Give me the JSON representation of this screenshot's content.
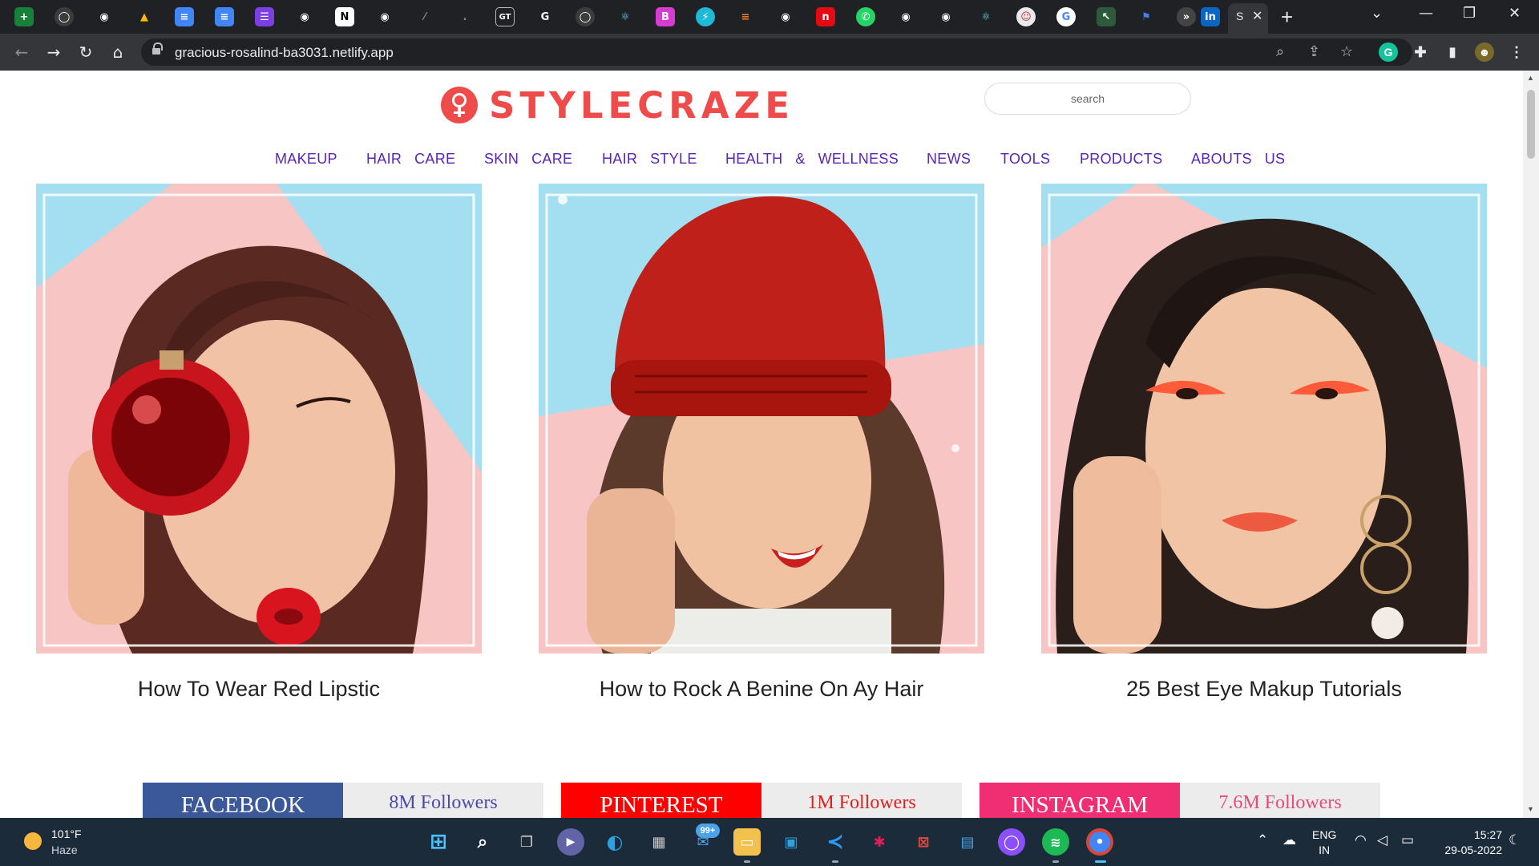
{
  "browser": {
    "tab_title_fragment": "S",
    "url": "gracious-rosalind-ba3031.netlify.app"
  },
  "site": {
    "logo_text": "STYLECRAZE",
    "search_placeholder": "search",
    "nav": [
      "MAKEUP",
      "HAIR   CARE",
      "SKIN   CARE",
      "HAIR   STYLE",
      "HEALTH   &   WELLNESS",
      "NEWS",
      "TOOLS",
      "PRODUCTS",
      "ABOUTS   US"
    ],
    "articles": [
      {
        "title": "How To Wear Red Lipstic"
      },
      {
        "title": "How to Rock A Benine On Ay Hair"
      },
      {
        "title": "25 Best Eye Makup Tutorials"
      }
    ],
    "social": [
      {
        "name": "FACEBOOK",
        "count": "8M Followers",
        "color": "#3b5998",
        "count_color": "#4a4aa8"
      },
      {
        "name": "PINTEREST",
        "count": "1M Followers",
        "color": "#ff0000",
        "count_color": "#e02020"
      },
      {
        "name": "INSTAGRAM",
        "count": "7.6M Followers",
        "color": "#f02e72",
        "count_color": "#e84a7a"
      }
    ],
    "accent": "#ee4b4b",
    "nav_color": "#5a23b8"
  },
  "taskbar": {
    "weather_temp": "101°F",
    "weather_desc": "Haze",
    "mail_badge": "99+",
    "lang_line1": "ENG",
    "lang_line2": "IN",
    "time": "15:27",
    "date": "29-05-2022"
  }
}
